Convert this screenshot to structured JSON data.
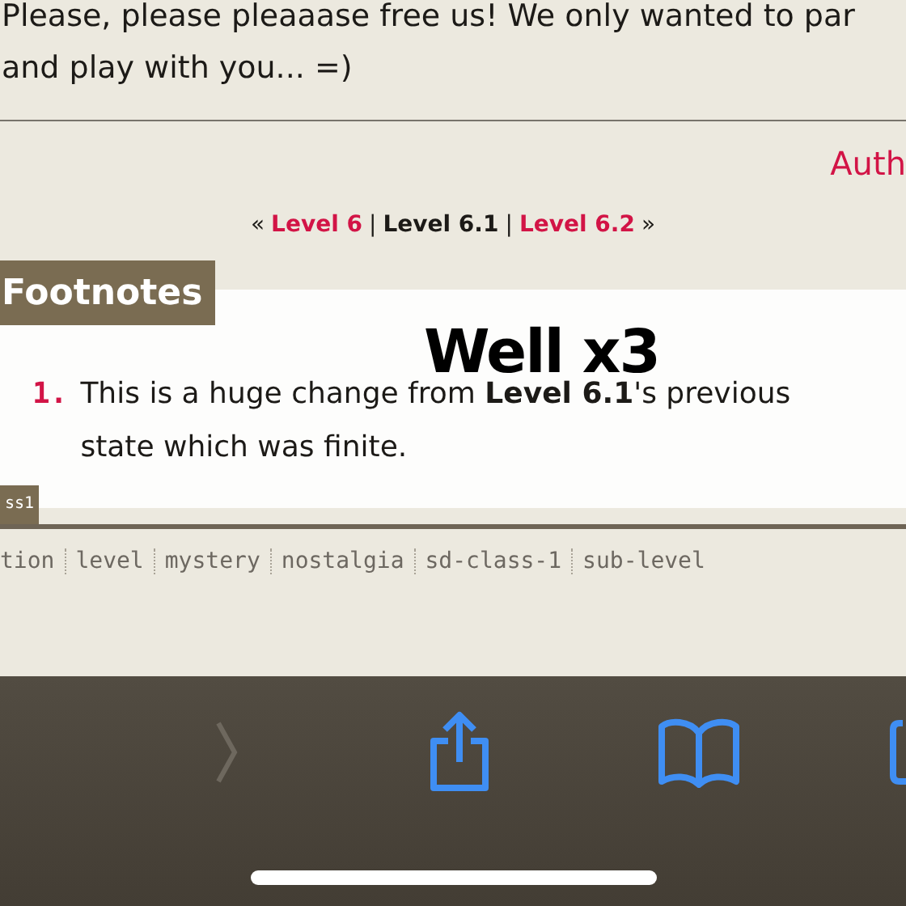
{
  "story_lines": [
    "Please, please pleaaase free us! We only wanted to par",
    "and play with you... =)"
  ],
  "author_link": "Auth",
  "level_nav": {
    "prev_mark": "«",
    "next_mark": "»",
    "separator": "|",
    "items": [
      {
        "label": "Level 6",
        "current": false
      },
      {
        "label": "Level 6.1",
        "current": true
      },
      {
        "label": "Level 6.2",
        "current": false
      }
    ]
  },
  "footnotes": {
    "heading": "Footnotes",
    "items": [
      {
        "number": "1.",
        "text": "This is a huge change from **Level 6.1**'s previous state which was finite."
      }
    ]
  },
  "overlay_caption": "Well x3",
  "class_tab": "ss1",
  "tags": [
    "tion",
    "level",
    "mystery",
    "nostalgia",
    "sd-class-1",
    "sub-level"
  ],
  "toolbar": [
    {
      "kind": "forward",
      "disabled": true
    },
    {
      "kind": "share",
      "disabled": false
    },
    {
      "kind": "bookmarks",
      "disabled": false
    },
    {
      "kind": "tabs",
      "disabled": false
    }
  ]
}
